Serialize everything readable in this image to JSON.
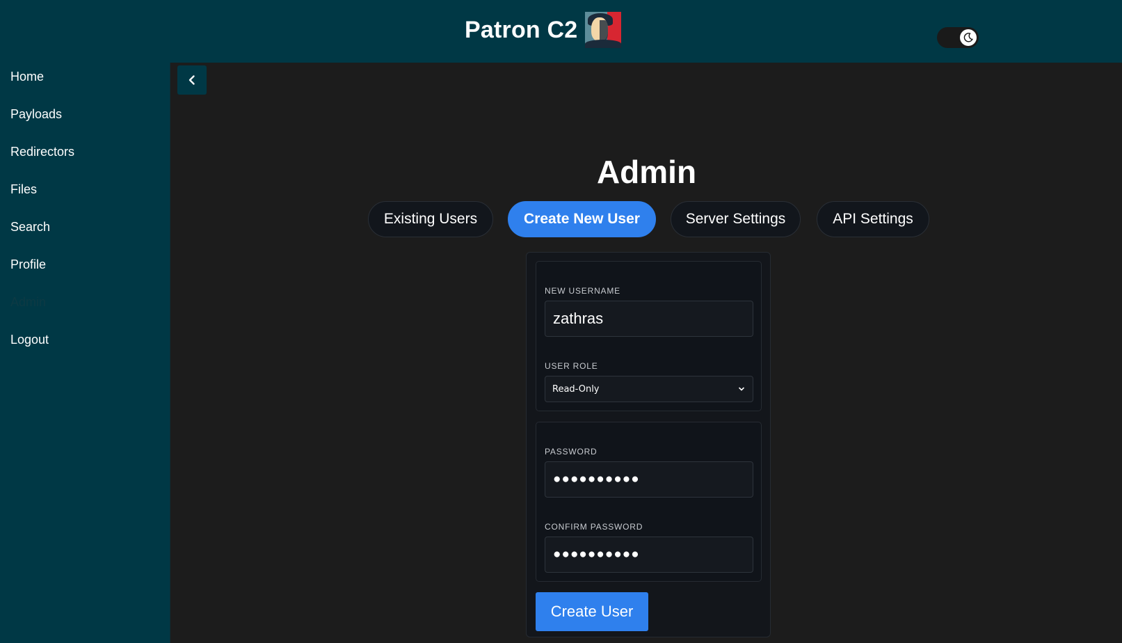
{
  "header": {
    "title": "Patron C2",
    "logo": "patron-portrait-logo",
    "theme_toggle_icon": "moon-icon"
  },
  "sidebar": {
    "items": [
      {
        "label": "Home"
      },
      {
        "label": "Payloads"
      },
      {
        "label": "Redirectors"
      },
      {
        "label": "Files"
      },
      {
        "label": "Search"
      },
      {
        "label": "Profile"
      },
      {
        "label": "Admin",
        "active": true
      },
      {
        "label": "Logout"
      }
    ]
  },
  "main": {
    "back_icon": "chevron-left-icon",
    "title": "Admin",
    "tabs": [
      {
        "label": "Existing Users"
      },
      {
        "label": "Create New User",
        "active": true
      },
      {
        "label": "Server Settings"
      },
      {
        "label": "API Settings"
      }
    ],
    "form": {
      "username_label": "NEW USERNAME",
      "username_value": "zathras",
      "role_label": "USER ROLE",
      "role_value": "Read-Only",
      "password_label": "PASSWORD",
      "password_value": "●●●●●●●●●●",
      "confirm_label": "CONFIRM PASSWORD",
      "confirm_value": "●●●●●●●●●●",
      "submit_label": "Create User"
    }
  },
  "colors": {
    "header_bg": "#003845",
    "main_bg": "#1c1c1c",
    "accent": "#2f80ed"
  }
}
